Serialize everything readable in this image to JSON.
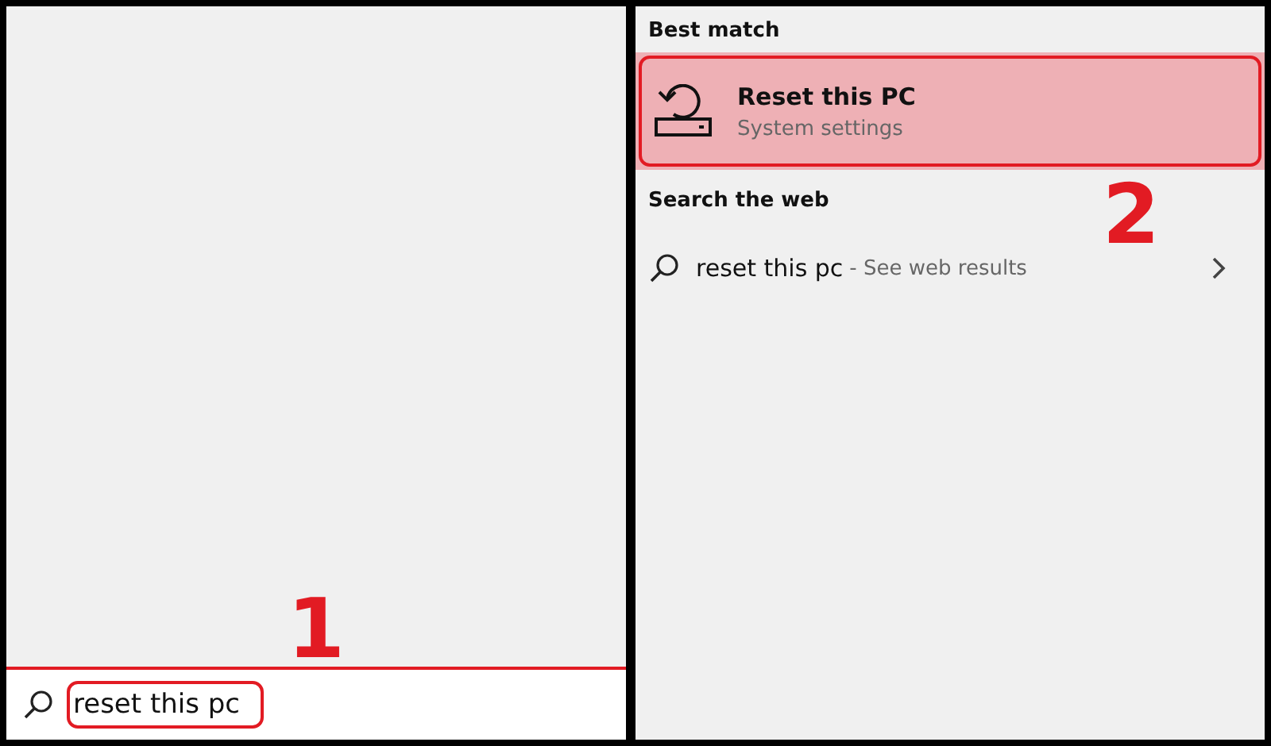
{
  "search_box": {
    "value": "reset this pc",
    "annotation": "1"
  },
  "results": {
    "best_match_heading": "Best match",
    "best_match": {
      "title": "Reset this PC",
      "subtitle": "System settings",
      "selected": true
    },
    "web_heading": "Search the web",
    "web_result": {
      "query": "reset this pc",
      "suffix": "- See web results",
      "selected": false
    },
    "annotation": "2"
  }
}
